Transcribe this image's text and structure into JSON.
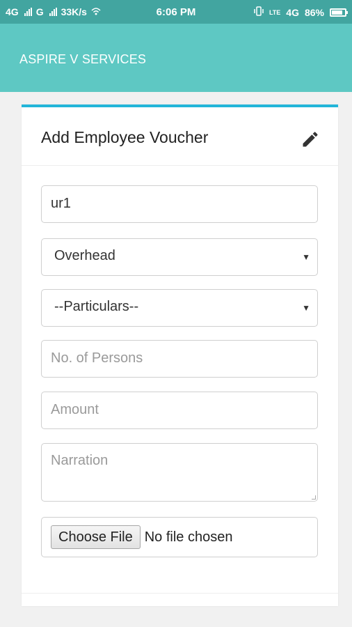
{
  "status_bar": {
    "net1": "4G",
    "net2": "G",
    "speed": "33K/s",
    "time": "6:06 PM",
    "lte": "LTE",
    "net3": "4G",
    "battery": "86%",
    "battery_level": 0.86
  },
  "app_bar": {
    "title": "ASPIRE V SERVICES"
  },
  "form": {
    "heading": "Add Employee Voucher",
    "user_value": "ur1",
    "category_selected": "Overhead",
    "particulars_selected": "--Particulars--",
    "persons_placeholder": "No. of Persons",
    "amount_placeholder": "Amount",
    "narration_placeholder": "Narration",
    "file_button": "Choose File",
    "file_status": "No file chosen"
  },
  "colors": {
    "status_bar": "#42a5a0",
    "app_bar": "#5ec8c3",
    "card_accent": "#22b5d9"
  },
  "icons": [
    "signal-icon",
    "wifi-icon",
    "vibrate-icon",
    "battery-icon",
    "edit-icon",
    "dropdown-caret-icon"
  ]
}
